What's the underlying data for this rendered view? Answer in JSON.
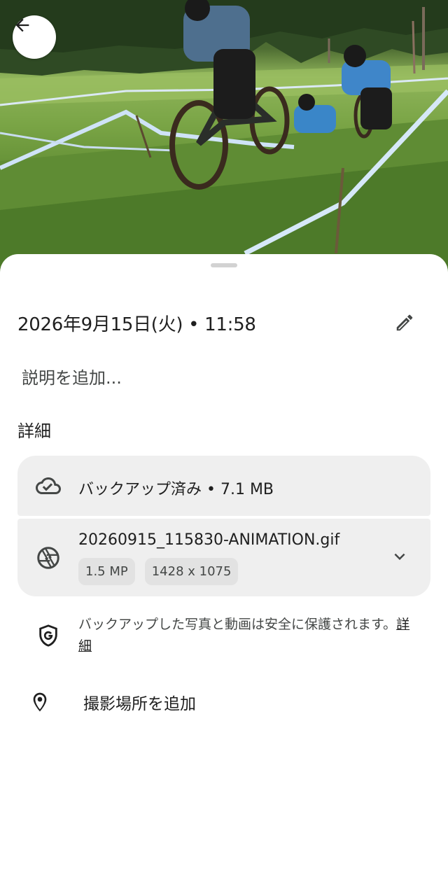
{
  "header": {
    "back_icon": "arrow-back-icon"
  },
  "info": {
    "datetime": "2026年9月15日(火) • 11:58",
    "edit_icon": "pencil-icon",
    "description_placeholder": "説明を追加..."
  },
  "details": {
    "title": "詳細",
    "backup": {
      "icon": "cloud-done-icon",
      "label": "バックアップ済み • 7.1 MB"
    },
    "file": {
      "icon": "shutter-icon",
      "name": "20260915_115830-ANIMATION.gif",
      "megapixels": "1.5 MP",
      "resolution": "1428 x 1075",
      "expand_icon": "chevron-down-icon"
    },
    "security": {
      "icon": "shield-g-icon",
      "text": "バックアップした写真と動画は安全に保護されます。",
      "link": "詳細"
    },
    "location": {
      "icon": "location-pin-icon",
      "label": "撮影場所を追加"
    }
  },
  "colors": {
    "sheet_background": "#ffffff",
    "card_background": "#efefef",
    "chip_background": "#e2e2e2",
    "primary_text": "#1f1f1f",
    "secondary_text": "#444746"
  }
}
